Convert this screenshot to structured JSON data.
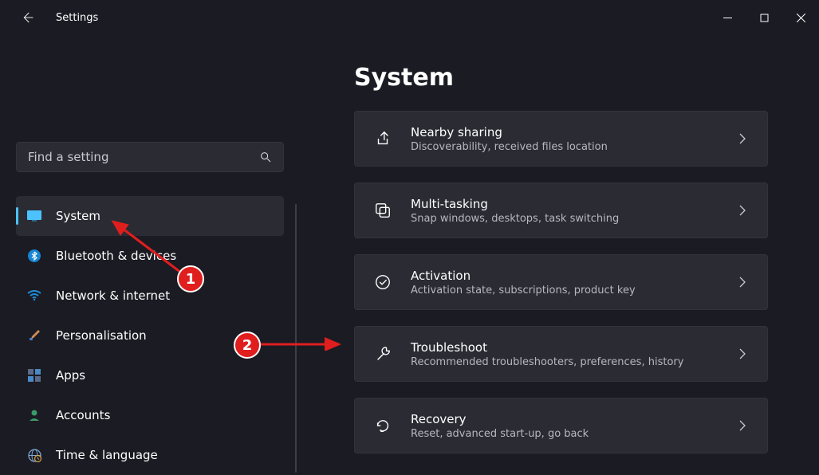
{
  "app_title": "Settings",
  "search": {
    "placeholder": "Find a setting"
  },
  "sidebar": {
    "items": [
      {
        "label": "System"
      },
      {
        "label": "Bluetooth & devices"
      },
      {
        "label": "Network & internet"
      },
      {
        "label": "Personalisation"
      },
      {
        "label": "Apps"
      },
      {
        "label": "Accounts"
      },
      {
        "label": "Time & language"
      }
    ]
  },
  "page": {
    "title": "System",
    "cards": [
      {
        "title": "Nearby sharing",
        "sub": "Discoverability, received files location"
      },
      {
        "title": "Multi-tasking",
        "sub": "Snap windows, desktops, task switching"
      },
      {
        "title": "Activation",
        "sub": "Activation state, subscriptions, product key"
      },
      {
        "title": "Troubleshoot",
        "sub": "Recommended troubleshooters, preferences, history"
      },
      {
        "title": "Recovery",
        "sub": "Reset, advanced start-up, go back"
      }
    ]
  },
  "annotations": {
    "1": "1",
    "2": "2"
  }
}
